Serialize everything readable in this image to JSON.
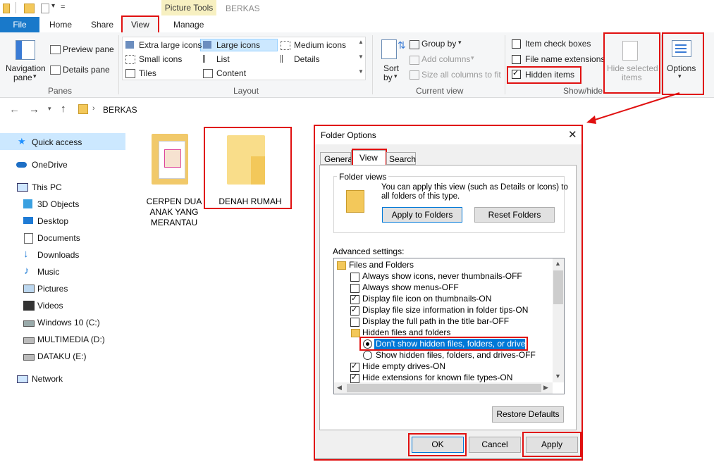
{
  "titlebar": {
    "context_tab": "Picture Tools",
    "window_title": "BERKAS"
  },
  "tabs": {
    "file": "File",
    "home": "Home",
    "share": "Share",
    "view": "View",
    "manage": "Manage"
  },
  "ribbon": {
    "panes": {
      "navigation_pane": "Navigation",
      "navigation_pane2": "pane",
      "preview_pane": "Preview pane",
      "details_pane": "Details pane",
      "group": "Panes"
    },
    "layout": {
      "extra_large": "Extra large icons",
      "large": "Large icons",
      "medium": "Medium icons",
      "small": "Small icons",
      "list": "List",
      "details": "Details",
      "tiles": "Tiles",
      "content": "Content",
      "group": "Layout"
    },
    "current_view": {
      "sort_by": "Sort",
      "sort_by2": "by",
      "group_by": "Group by",
      "add_columns": "Add columns",
      "size_all": "Size all columns to fit",
      "group": "Current view"
    },
    "show_hide": {
      "item_check_boxes": "Item check boxes",
      "file_name_extensions": "File name extensions",
      "hidden_items": "Hidden items",
      "hide_selected": "Hide selected",
      "hide_selected2": "items",
      "group": "Show/hide",
      "hidden_items_checked": true
    },
    "options": "Options"
  },
  "address": {
    "path": "BERKAS"
  },
  "nav": {
    "quick_access": "Quick access",
    "onedrive": "OneDrive",
    "this_pc": "This PC",
    "objects3d": "3D Objects",
    "desktop": "Desktop",
    "documents": "Documents",
    "downloads": "Downloads",
    "music": "Music",
    "pictures": "Pictures",
    "videos": "Videos",
    "windows": "Windows 10 (C:)",
    "multimedia": "MULTIMEDIA (D:)",
    "dataku": "DATAKU (E:)",
    "network": "Network"
  },
  "files": [
    {
      "name1": "CERPEN DUA",
      "name2": "ANAK YANG",
      "name3": "MERANTAU"
    },
    {
      "name1": "DENAH RUMAH"
    }
  ],
  "dialog": {
    "title": "Folder Options",
    "tabs": {
      "general": "General",
      "view": "View",
      "search": "Search"
    },
    "folder_views": {
      "heading": "Folder views",
      "desc1": "You can apply this view (such as Details or Icons) to",
      "desc2": "all folders of this type.",
      "apply": "Apply to Folders",
      "reset": "Reset Folders"
    },
    "advanced_heading": "Advanced settings:",
    "advanced": [
      {
        "label": "Files and Folders",
        "kind": "folder"
      },
      {
        "label": "Always show icons, never thumbnails-OFF",
        "kind": "check",
        "checked": false
      },
      {
        "label": "Always show menus-OFF",
        "kind": "check",
        "checked": false
      },
      {
        "label": "Display file icon on thumbnails-ON",
        "kind": "check",
        "checked": true
      },
      {
        "label": "Display file size information in folder tips-ON",
        "kind": "check",
        "checked": true
      },
      {
        "label": "Display the full path in the title bar-OFF",
        "kind": "check",
        "checked": false
      },
      {
        "label": "Hidden files and folders",
        "kind": "folder"
      },
      {
        "label": "Don't show hidden files, folders, or drives-ON",
        "kind": "radio",
        "checked": true
      },
      {
        "label": "Show hidden files, folders, and drives-OFF",
        "kind": "radio",
        "checked": false
      },
      {
        "label": "Hide empty drives-ON",
        "kind": "check",
        "checked": true
      },
      {
        "label": "Hide extensions for known file types-ON",
        "kind": "check",
        "checked": true
      }
    ],
    "restore": "Restore Defaults",
    "ok": "OK",
    "cancel": "Cancel",
    "apply": "Apply"
  },
  "colors": {
    "accent": "#1979ca",
    "highlight": "#cce8ff",
    "annotation": "#e01010",
    "selection": "#0078d7"
  }
}
